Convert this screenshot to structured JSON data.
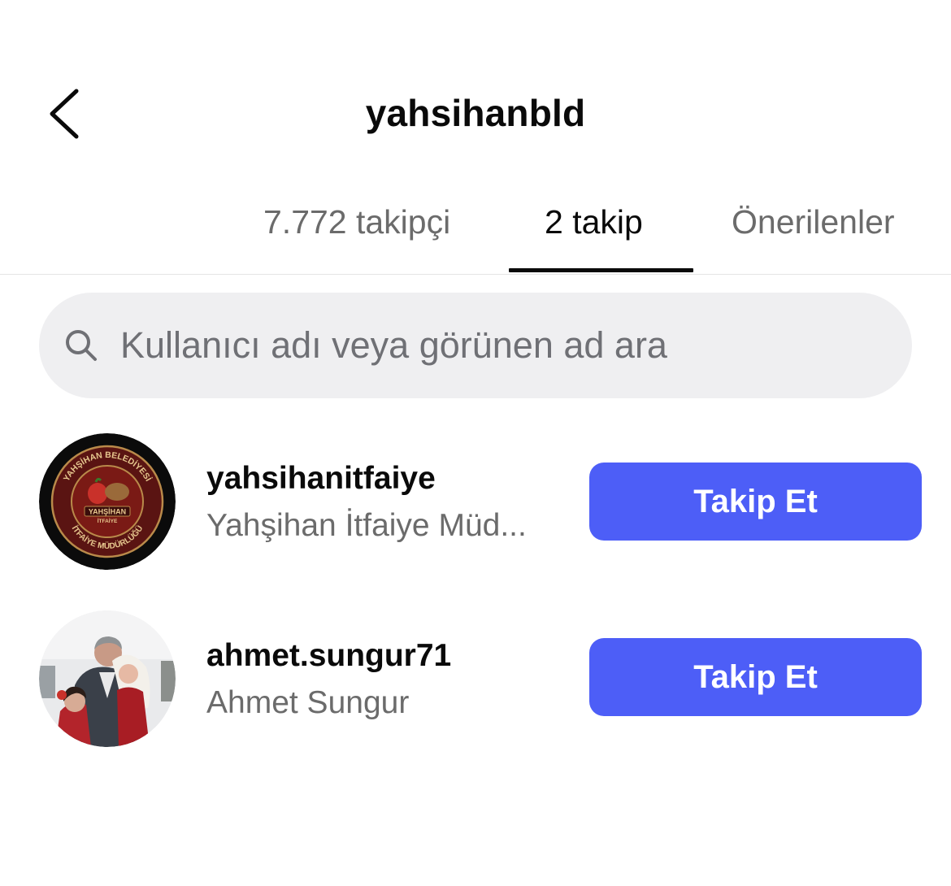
{
  "header": {
    "title": "yahsihanbld",
    "back_icon": "chevron-left-icon"
  },
  "tabs": [
    {
      "label": "7.772 takipçi",
      "active": false
    },
    {
      "label": "2 takip",
      "active": true
    },
    {
      "label": "Önerilenler",
      "active": false
    }
  ],
  "search": {
    "placeholder": "Kullanıcı adı veya görünen ad ara",
    "value": "",
    "icon": "search-icon"
  },
  "users": [
    {
      "username": "yahsihanitfaiye",
      "display_name": "Yahşihan İtfaiye Müd...",
      "button_label": "Takip Et",
      "avatar": "fire-department-logo-avatar",
      "avatar_logo_text": [
        "YAHŞİHAN BELEDİYESİ",
        "YAHŞİHAN İTFAİYE",
        "İTFAİYE MÜDÜRLÜĞÜ"
      ]
    },
    {
      "username": "ahmet.sungur71",
      "display_name": "Ahmet Sungur",
      "button_label": "Takip Et",
      "avatar": "profile-photo-avatar"
    }
  ],
  "colors": {
    "accent": "#4d5ef7",
    "text_primary": "#0a0a0a",
    "text_secondary": "#6b6b6b",
    "search_bg": "#efeff1",
    "divider": "#e5e5e5"
  }
}
